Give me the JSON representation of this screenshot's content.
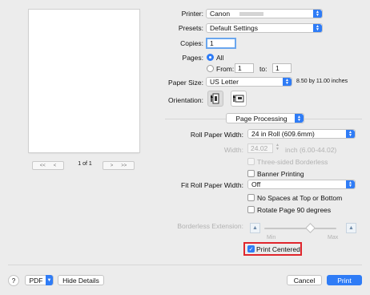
{
  "preview": {
    "page_indicator": "1 of 1",
    "nav_first": "<<",
    "nav_prev": "<",
    "nav_next": ">",
    "nav_last": ">>"
  },
  "printer": {
    "label": "Printer:",
    "value": "Canon"
  },
  "presets": {
    "label": "Presets:",
    "value": "Default Settings"
  },
  "copies": {
    "label": "Copies:",
    "value": "1"
  },
  "pages": {
    "label": "Pages:",
    "all_label": "All",
    "from_label": "From:",
    "from_value": "1",
    "to_label": "to:",
    "to_value": "1"
  },
  "paper_size": {
    "label": "Paper Size:",
    "value": "US Letter",
    "dimensions": "8.50 by 11.00 inches"
  },
  "orientation": {
    "label": "Orientation:"
  },
  "section": {
    "value": "Page Processing"
  },
  "roll_paper_width": {
    "label": "Roll Paper Width:",
    "value": "24 in Roll (609.6mm)"
  },
  "width": {
    "label": "Width:",
    "value": "24.02",
    "range": "inch (6.00-44.02)"
  },
  "three_sided_borderless": {
    "label": "Three-sided Borderless"
  },
  "banner_printing": {
    "label": "Banner Printing"
  },
  "fit_roll_paper_width": {
    "label": "Fit Roll Paper Width:",
    "value": "Off"
  },
  "no_spaces": {
    "label": "No Spaces at Top or Bottom"
  },
  "rotate_page": {
    "label": "Rotate Page 90 degrees"
  },
  "borderless_extension": {
    "label": "Borderless Extension:",
    "min": "Min",
    "max": "Max"
  },
  "print_centered": {
    "label": "Print Centered"
  },
  "footer": {
    "help": "?",
    "pdf": "PDF",
    "hide_details": "Hide Details",
    "cancel": "Cancel",
    "print": "Print"
  }
}
